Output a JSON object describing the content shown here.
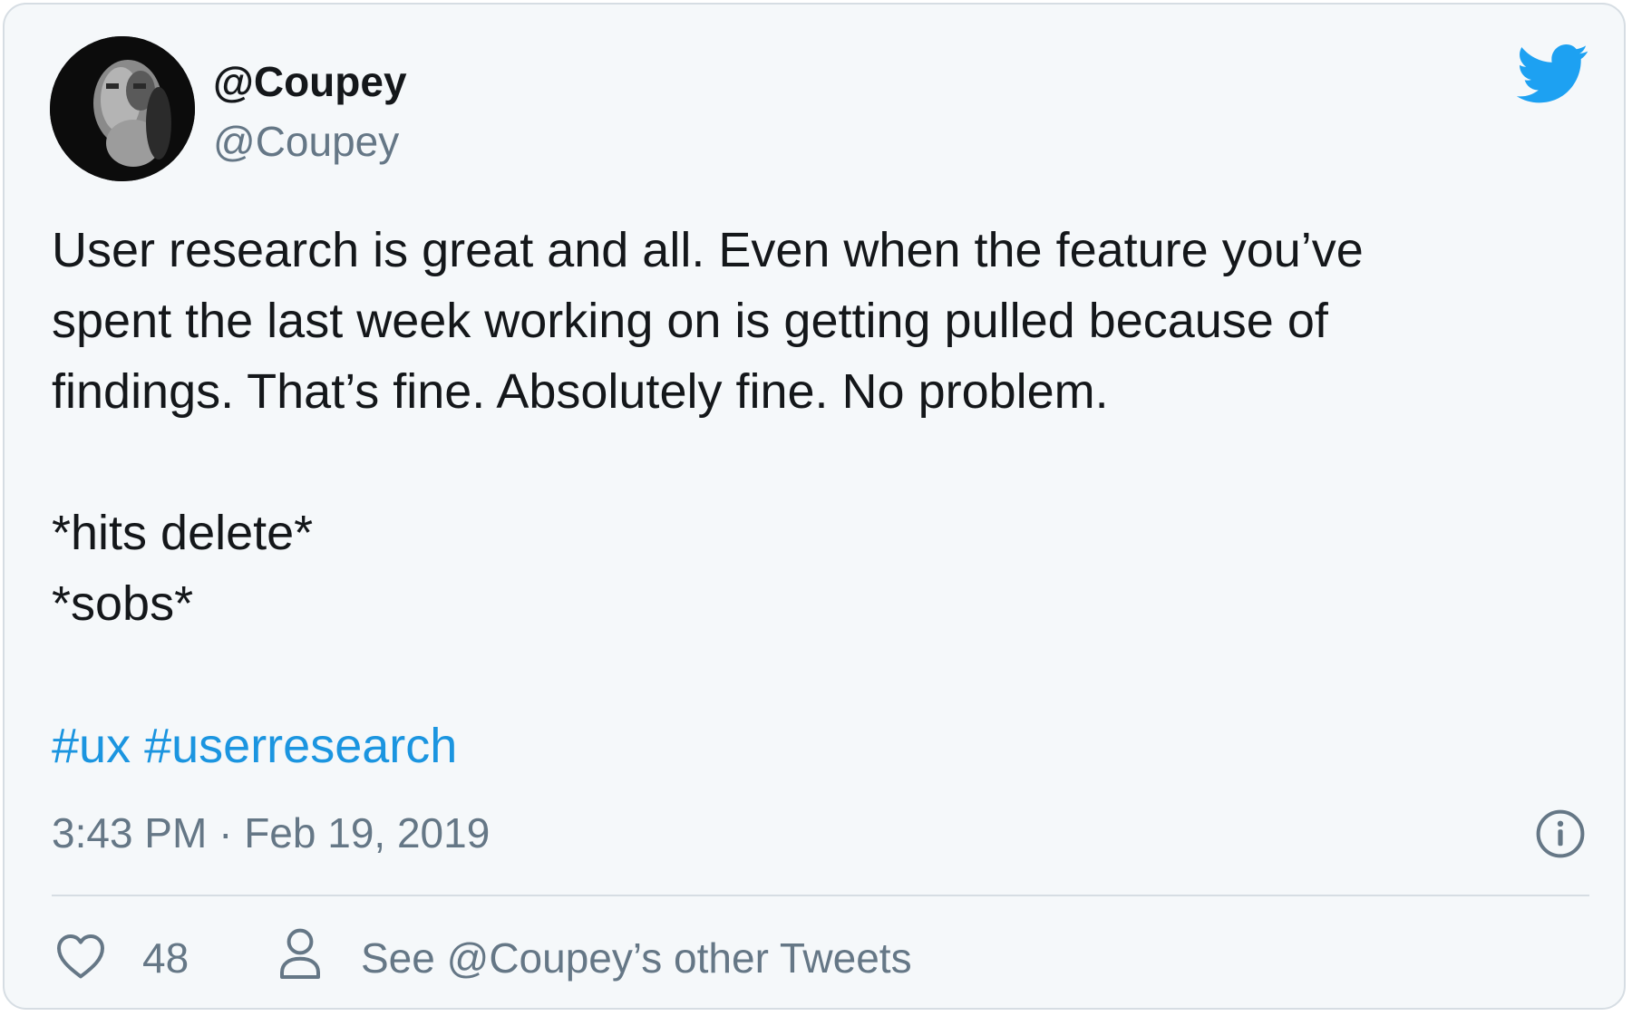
{
  "author": {
    "display_name": "@Coupey",
    "handle": "@Coupey"
  },
  "icons": {
    "brand": "twitter-bird-icon",
    "info": "info-icon",
    "like": "heart-icon",
    "profile": "person-icon"
  },
  "tweet": {
    "lines": [
      "User research is great and all. Even when the feature you’ve",
      "spent the last week working on is getting pulled because of",
      "findings. That’s fine. Absolutely fine. No problem."
    ],
    "actions": [
      "*hits delete*",
      "*sobs*"
    ],
    "hashtags": [
      "#ux",
      "#userresearch"
    ]
  },
  "meta": {
    "timestamp": "3:43 PM · Feb 19, 2019"
  },
  "footer": {
    "like_count": "48",
    "other_tweets_label": "See @Coupey’s other Tweets"
  },
  "colors": {
    "background": "#f5f8fa",
    "border": "#d6dde3",
    "text": "#14171a",
    "secondary": "#657786",
    "link": "#1b95e0",
    "brand": "#1da1f2"
  }
}
